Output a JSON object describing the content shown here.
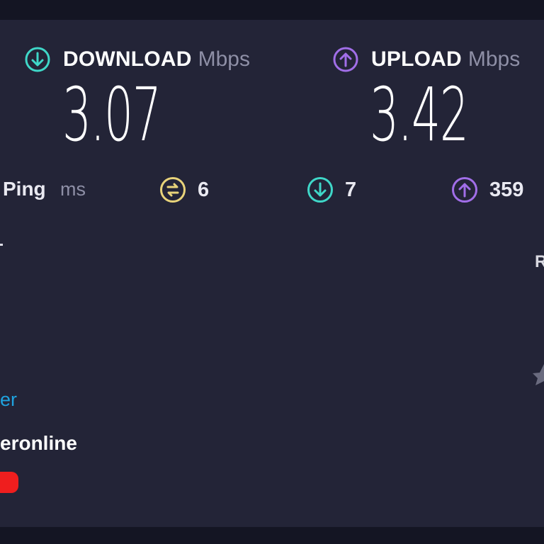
{
  "download": {
    "title": "DOWNLOAD",
    "unit": "Mbps",
    "value": "3.07",
    "icon": "arrow-down-circle-icon",
    "color": "#3fd7c8"
  },
  "upload": {
    "title": "UPLOAD",
    "unit": "Mbps",
    "value": "3.42",
    "icon": "arrow-up-circle-icon",
    "color": "#a16ee8"
  },
  "ping": {
    "label": "Ping",
    "unit": "ms",
    "jitter": {
      "icon": "jitter-swap-icon",
      "value": "6",
      "color": "#e8d37a"
    },
    "download_latency": {
      "icon": "arrow-down-circle-icon",
      "value": "7",
      "color": "#3fd7c8"
    },
    "upload_latency": {
      "icon": "arrow-up-circle-icon",
      "value": "359",
      "color": "#a16ee8"
    }
  },
  "right_edge_fragment": "R",
  "link_fragment": "er",
  "isp_fragment": "eronline"
}
